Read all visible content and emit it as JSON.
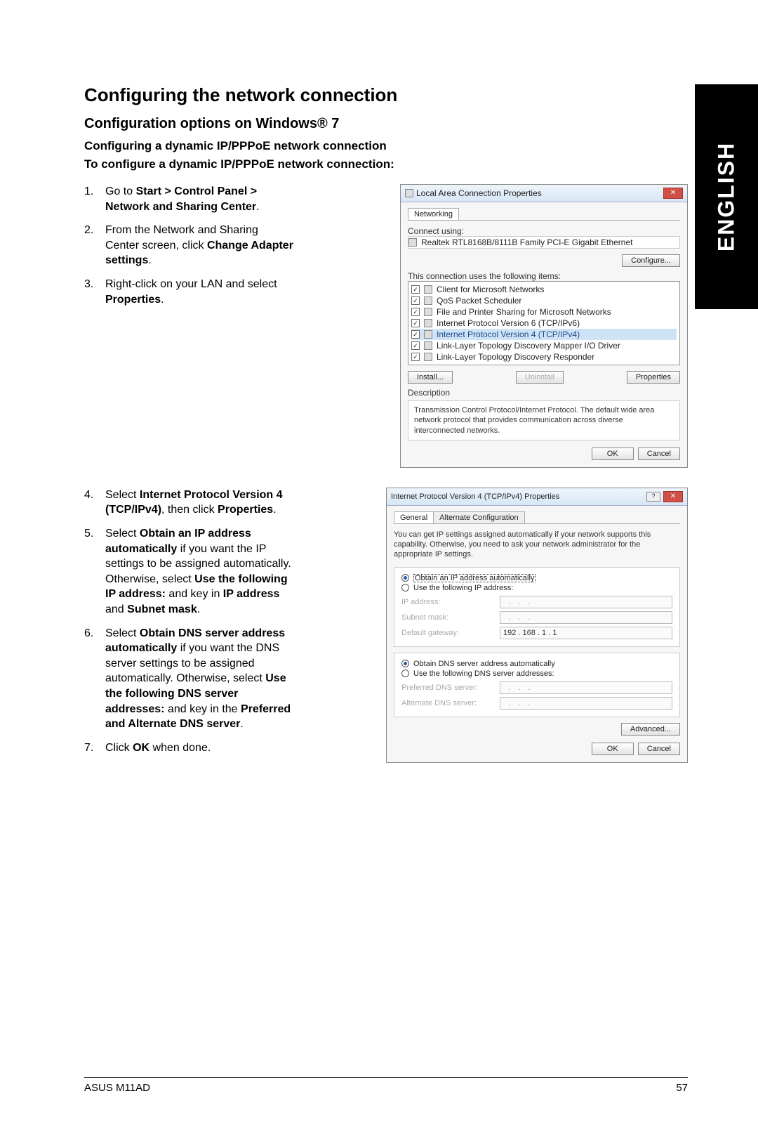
{
  "sideTab": "ENGLISH",
  "h1": "Configuring the network connection",
  "h2": "Configuration options on Windows® 7",
  "h3": "Configuring a dynamic IP/PPPoE network connection",
  "h4": "To configure a dynamic IP/PPPoE network connection:",
  "steps1": {
    "s1a": "Go to ",
    "s1b": "Start > Control Panel > Network and Sharing Center",
    "s1c": ".",
    "s2a": "From the Network and Sharing Center screen, click ",
    "s2b": "Change Adapter settings",
    "s2c": ".",
    "s3a": "Right-click on your LAN and select ",
    "s3b": "Properties",
    "s3c": "."
  },
  "steps2": {
    "s4a": "Select ",
    "s4b": "Internet Protocol Version 4 (TCP/IPv4)",
    "s4c": ", then click ",
    "s4d": "Properties",
    "s4e": ".",
    "s5a": "Select ",
    "s5b": "Obtain an IP address automatically",
    "s5c": " if you want the IP settings to be assigned automatically. Otherwise, select ",
    "s5d": "Use the following IP address:",
    "s5e": " and key in ",
    "s5f": "IP address",
    "s5g": " and ",
    "s5h": "Subnet mask",
    "s5i": ".",
    "s6a": "Select ",
    "s6b": "Obtain DNS server address automatically",
    "s6c": " if you want the DNS server settings to be assigned automatically. Otherwise, select ",
    "s6d": "Use the following DNS server addresses:",
    "s6e": " and key in the ",
    "s6f": "Preferred and Alternate DNS server",
    "s6g": ".",
    "s7a": "Click ",
    "s7b": "OK",
    "s7c": " when done."
  },
  "dlg1": {
    "title": "Local Area Connection Properties",
    "tab": "Networking",
    "connectUsingLabel": "Connect using:",
    "adapter": "Realtek RTL8168B/8111B Family PCI-E Gigabit Ethernet",
    "configureBtn": "Configure...",
    "itemsLabel": "This connection uses the following items:",
    "items": [
      "Client for Microsoft Networks",
      "QoS Packet Scheduler",
      "File and Printer Sharing for Microsoft Networks",
      "Internet Protocol Version 6 (TCP/IPv6)",
      "Internet Protocol Version 4 (TCP/IPv4)",
      "Link-Layer Topology Discovery Mapper I/O Driver",
      "Link-Layer Topology Discovery Responder"
    ],
    "installBtn": "Install...",
    "uninstallBtn": "Uninstall",
    "propertiesBtn": "Properties",
    "descLabel": "Description",
    "descText": "Transmission Control Protocol/Internet Protocol. The default wide area network protocol that provides communication across diverse interconnected networks.",
    "okBtn": "OK",
    "cancelBtn": "Cancel"
  },
  "dlg2": {
    "title": "Internet Protocol Version 4 (TCP/IPv4) Properties",
    "tab1": "General",
    "tab2": "Alternate Configuration",
    "note": "You can get IP settings assigned automatically if your network supports this capability. Otherwise, you need to ask your network administrator for the appropriate IP settings.",
    "r1": "Obtain an IP address automatically",
    "r2": "Use the following IP address:",
    "ipLabel": "IP address:",
    "subnetLabel": "Subnet mask:",
    "gatewayLabel": "Default gateway:",
    "gatewayVal": "192 . 168 .   1  .   1",
    "r3": "Obtain DNS server address automatically",
    "r4": "Use the following DNS server addresses:",
    "prefDns": "Preferred DNS server:",
    "altDns": "Alternate DNS server:",
    "advanced": "Advanced...",
    "okBtn": "OK",
    "cancelBtn": "Cancel"
  },
  "footer": {
    "left": "ASUS M11AD",
    "right": "57"
  }
}
